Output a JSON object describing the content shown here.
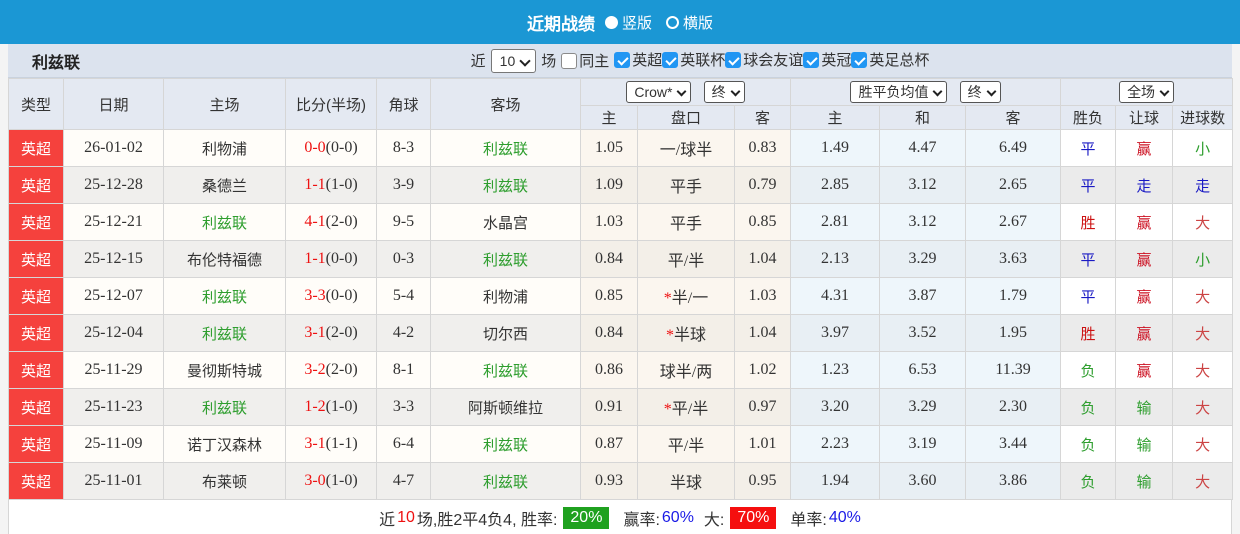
{
  "titlebar": {
    "title": "近期战绩",
    "radio_vertical": "竖版",
    "radio_horizontal": "横版"
  },
  "filterbar": {
    "team": "利兹联",
    "recent_label": "近",
    "recent_value": "10",
    "matches_label": "场",
    "same_home": {
      "label": "同主",
      "checked": false
    },
    "leagues": [
      {
        "label": "英超",
        "checked": true
      },
      {
        "label": "英联杯",
        "checked": true
      },
      {
        "label": "球会友谊",
        "checked": true
      },
      {
        "label": "英冠",
        "checked": true
      },
      {
        "label": "英足总杯",
        "checked": true
      }
    ]
  },
  "table": {
    "static_headers": [
      "类型",
      "日期",
      "主场",
      "比分(半场)",
      "角球",
      "客场"
    ],
    "selects": {
      "crow": "Crow*",
      "crow_final": "终",
      "avg": "胜平负均值",
      "avg_final": "终",
      "fulltime": "全场"
    },
    "subheaders": [
      "主",
      "盘口",
      "客",
      "主",
      "和",
      "客",
      "胜负",
      "让球",
      "进球数"
    ],
    "rows": [
      {
        "type": "英超",
        "date": "26-01-02",
        "home": "利物浦",
        "home_team": false,
        "score": "0-0",
        "half": "(0-0)",
        "corner": "8-3",
        "away": "利兹联",
        "away_team": true,
        "h_home": "1.05",
        "star": false,
        "handicap": "一/球半",
        "h_away": "0.83",
        "o_home": "1.49",
        "o_draw": "4.47",
        "o_away": "6.49",
        "res": "平",
        "let": "赢",
        "goal": "小"
      },
      {
        "type": "英超",
        "date": "25-12-28",
        "home": "桑德兰",
        "home_team": false,
        "score": "1-1",
        "half": "(1-0)",
        "corner": "3-9",
        "away": "利兹联",
        "away_team": true,
        "h_home": "1.09",
        "star": false,
        "handicap": "平手",
        "h_away": "0.79",
        "o_home": "2.85",
        "o_draw": "3.12",
        "o_away": "2.65",
        "res": "平",
        "let": "走",
        "goal": "走"
      },
      {
        "type": "英超",
        "date": "25-12-21",
        "home": "利兹联",
        "home_team": true,
        "score": "4-1",
        "half": "(2-0)",
        "corner": "9-5",
        "away": "水晶宫",
        "away_team": false,
        "h_home": "1.03",
        "star": false,
        "handicap": "平手",
        "h_away": "0.85",
        "o_home": "2.81",
        "o_draw": "3.12",
        "o_away": "2.67",
        "res": "胜",
        "let": "赢",
        "goal": "大"
      },
      {
        "type": "英超",
        "date": "25-12-15",
        "home": "布伦特福德",
        "home_team": false,
        "score": "1-1",
        "half": "(0-0)",
        "corner": "0-3",
        "away": "利兹联",
        "away_team": true,
        "h_home": "0.84",
        "star": false,
        "handicap": "平/半",
        "h_away": "1.04",
        "o_home": "2.13",
        "o_draw": "3.29",
        "o_away": "3.63",
        "res": "平",
        "let": "赢",
        "goal": "小"
      },
      {
        "type": "英超",
        "date": "25-12-07",
        "home": "利兹联",
        "home_team": true,
        "score": "3-3",
        "half": "(0-0)",
        "corner": "5-4",
        "away": "利物浦",
        "away_team": false,
        "h_home": "0.85",
        "star": true,
        "handicap": "半/一",
        "h_away": "1.03",
        "o_home": "4.31",
        "o_draw": "3.87",
        "o_away": "1.79",
        "res": "平",
        "let": "赢",
        "goal": "大"
      },
      {
        "type": "英超",
        "date": "25-12-04",
        "home": "利兹联",
        "home_team": true,
        "score": "3-1",
        "half": "(2-0)",
        "corner": "4-2",
        "away": "切尔西",
        "away_team": false,
        "h_home": "0.84",
        "star": true,
        "handicap": "半球",
        "h_away": "1.04",
        "o_home": "3.97",
        "o_draw": "3.52",
        "o_away": "1.95",
        "res": "胜",
        "let": "赢",
        "goal": "大"
      },
      {
        "type": "英超",
        "date": "25-11-29",
        "home": "曼彻斯特城",
        "home_team": false,
        "score": "3-2",
        "half": "(2-0)",
        "corner": "8-1",
        "away": "利兹联",
        "away_team": true,
        "h_home": "0.86",
        "star": false,
        "handicap": "球半/两",
        "h_away": "1.02",
        "o_home": "1.23",
        "o_draw": "6.53",
        "o_away": "11.39",
        "res": "负",
        "let": "赢",
        "goal": "大"
      },
      {
        "type": "英超",
        "date": "25-11-23",
        "home": "利兹联",
        "home_team": true,
        "score": "1-2",
        "half": "(1-0)",
        "corner": "3-3",
        "away": "阿斯顿维拉",
        "away_team": false,
        "h_home": "0.91",
        "star": true,
        "handicap": "平/半",
        "h_away": "0.97",
        "o_home": "3.20",
        "o_draw": "3.29",
        "o_away": "2.30",
        "res": "负",
        "let": "输",
        "goal": "大"
      },
      {
        "type": "英超",
        "date": "25-11-09",
        "home": "诺丁汉森林",
        "home_team": false,
        "score": "3-1",
        "half": "(1-1)",
        "corner": "6-4",
        "away": "利兹联",
        "away_team": true,
        "h_home": "0.87",
        "star": false,
        "handicap": "平/半",
        "h_away": "1.01",
        "o_home": "2.23",
        "o_draw": "3.19",
        "o_away": "3.44",
        "res": "负",
        "let": "输",
        "goal": "大"
      },
      {
        "type": "英超",
        "date": "25-11-01",
        "home": "布莱顿",
        "home_team": false,
        "score": "3-0",
        "half": "(1-0)",
        "corner": "4-7",
        "away": "利兹联",
        "away_team": true,
        "h_home": "0.93",
        "star": false,
        "handicap": "半球",
        "h_away": "0.95",
        "o_home": "1.94",
        "o_draw": "3.60",
        "o_away": "3.86",
        "res": "负",
        "let": "输",
        "goal": "大"
      }
    ]
  },
  "summary": {
    "prefix1": "近",
    "count": "10",
    "prefix2": "场,胜2平4负4, 胜率:",
    "win_rate": "20%",
    "mid1": "赢率:",
    "win_pct": "60%",
    "mid2": "大:",
    "big_rate": "70%",
    "mid3": "单率:",
    "single_pct": "40%"
  },
  "colors": {
    "team": "#2e9e2e",
    "outcome_map": {
      "胜": "#cc1111",
      "平": "#1a1ac4",
      "负": "#2e9e2e",
      "赢": "#cc1122",
      "走": "#1a1ac4",
      "输": "#2e9e2e",
      "大": "#cc4444",
      "小": "#2e9e2e"
    }
  }
}
